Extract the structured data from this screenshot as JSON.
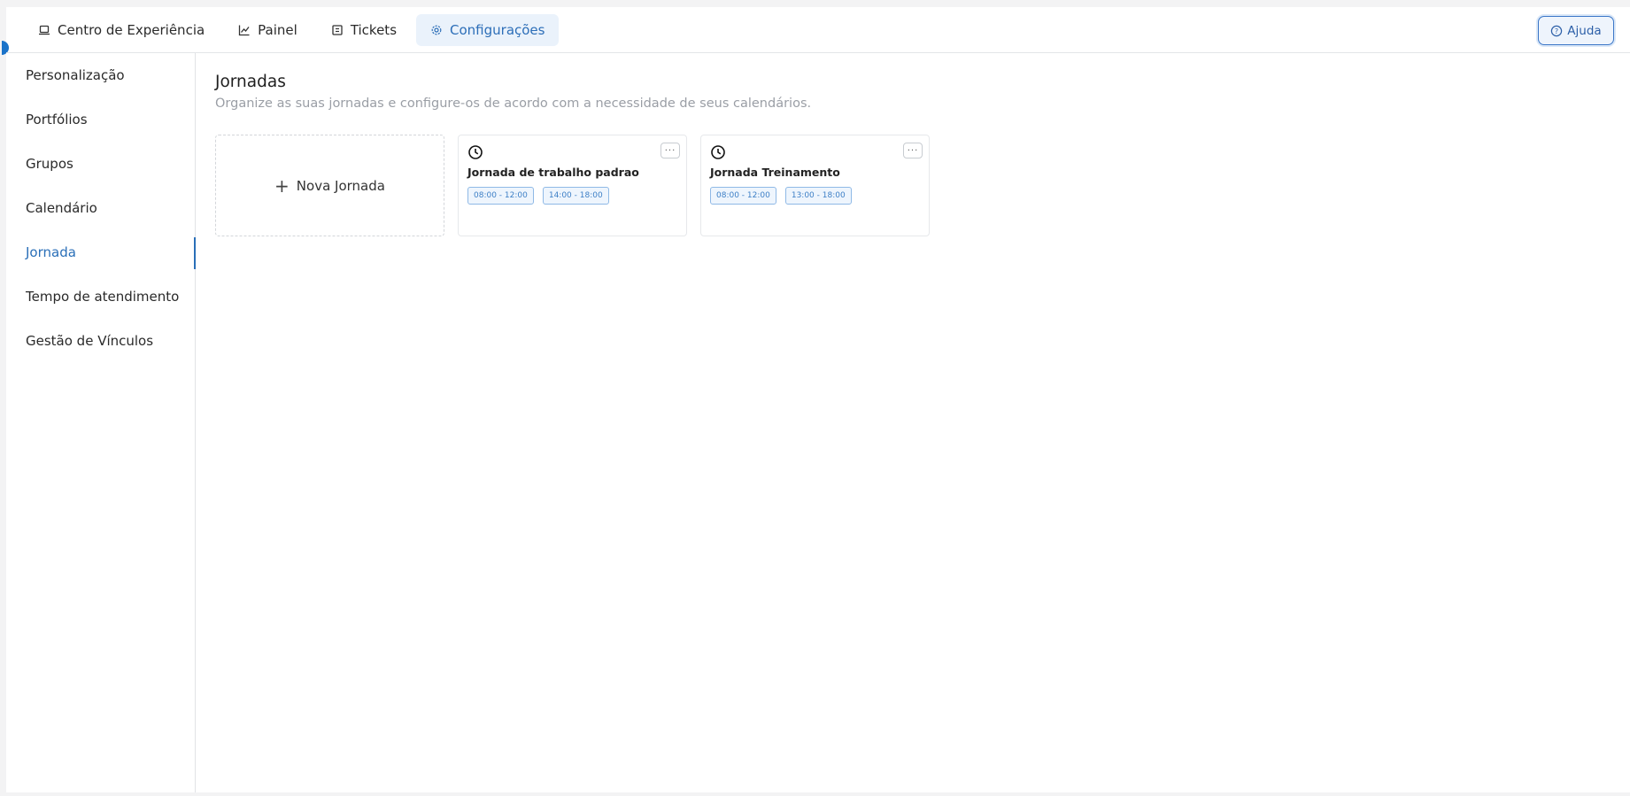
{
  "nav": {
    "tabs": [
      {
        "label": "Centro de Experiência",
        "icon": "laptop-icon"
      },
      {
        "label": "Painel",
        "icon": "chart-line-icon"
      },
      {
        "label": "Tickets",
        "icon": "ticket-icon"
      },
      {
        "label": "Configurações",
        "icon": "gear-icon",
        "active": true
      }
    ],
    "help_label": "Ajuda"
  },
  "sidebar": {
    "items": [
      {
        "label": "Personalização"
      },
      {
        "label": "Portfólios"
      },
      {
        "label": "Grupos"
      },
      {
        "label": "Calendário"
      },
      {
        "label": "Jornada",
        "active": true
      },
      {
        "label": "Tempo de atendimento"
      },
      {
        "label": "Gestão de Vínculos"
      }
    ]
  },
  "main": {
    "title": "Jornadas",
    "subtitle": "Organize as suas jornadas e configure-os de acordo com a necessidade de seus calendários.",
    "new_label": "Nova Jornada",
    "more_label": "···",
    "journeys": [
      {
        "title": "Jornada de trabalho padrao",
        "slots": [
          "08:00 - 12:00",
          "14:00 - 18:00"
        ]
      },
      {
        "title": "Jornada Treinamento",
        "slots": [
          "08:00 - 12:00",
          "13:00 - 18:00"
        ]
      }
    ]
  },
  "colors": {
    "accent": "#2a6fb8",
    "chip_border": "#8fb9e6",
    "chip_bg": "#eef5fd"
  }
}
